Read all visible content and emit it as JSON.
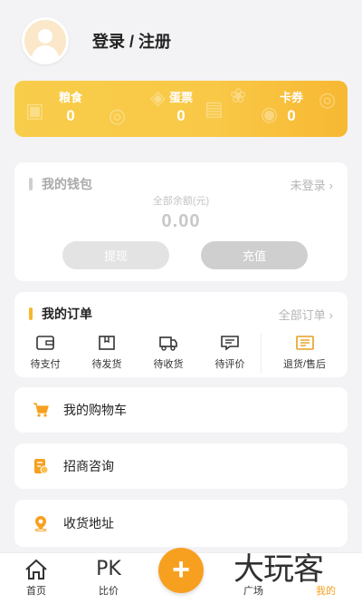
{
  "profile": {
    "login_label": "登录 / 注册"
  },
  "points": {
    "items": [
      {
        "label": "粮食",
        "value": "0"
      },
      {
        "label": "蛋票",
        "value": "0"
      },
      {
        "label": "卡券",
        "value": "0"
      }
    ],
    "color": "#f8cd4a"
  },
  "wallet": {
    "title": "我的钱包",
    "status": "未登录",
    "balance_label": "全部余额(元)",
    "balance": "0.00",
    "withdraw_label": "提现",
    "recharge_label": "充值"
  },
  "orders": {
    "title": "我的订单",
    "all_label": "全部订单",
    "items": [
      {
        "label": "待支付",
        "icon": "wallet-icon"
      },
      {
        "label": "待发货",
        "icon": "box-icon"
      },
      {
        "label": "待收货",
        "icon": "truck-icon"
      },
      {
        "label": "待评价",
        "icon": "comment-icon"
      },
      {
        "label": "退货/售后",
        "icon": "refund-icon"
      }
    ],
    "accent": "#f6b72c"
  },
  "menu": {
    "cart": "我的购物车",
    "business": "招商咨询",
    "address": "收货地址"
  },
  "tabbar": {
    "home": "首页",
    "compare": "比价",
    "compare_icon_text": "PK",
    "square": "广场",
    "mine": "我的",
    "accent": "#f7a020"
  },
  "watermark": "大玩客"
}
